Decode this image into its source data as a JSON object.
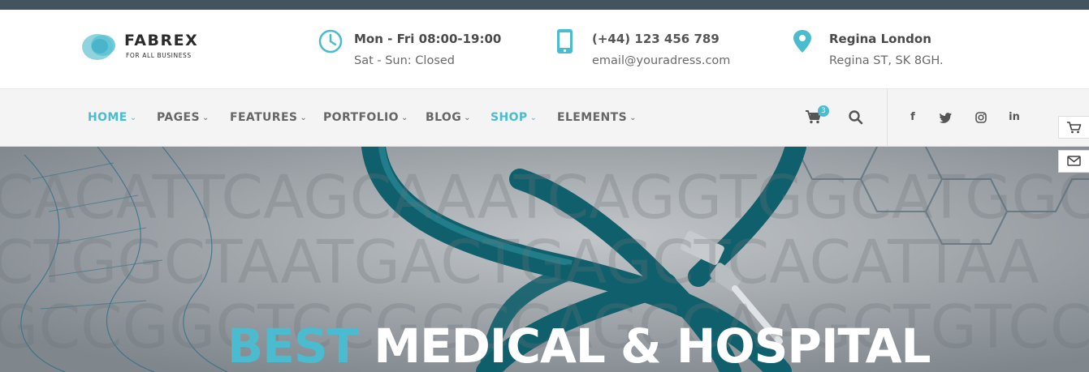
{
  "brand": {
    "name": "FABREX",
    "tagline": "FOR ALL BUSINESS",
    "accent_color": "#4bbcd0"
  },
  "header_info": {
    "hours": {
      "icon": "clock-icon",
      "line1": "Mon - Fri 08:00-19:00",
      "line2": "Sat - Sun: Closed"
    },
    "contact": {
      "icon": "phone-icon",
      "line1": "(+44) 123 456 789",
      "line2": "email@youradress.com"
    },
    "location": {
      "icon": "location-pin-icon",
      "line1": "Regina London",
      "line2": "Regina ST, SK 8GH."
    }
  },
  "nav": {
    "items": [
      {
        "label": "HOME",
        "active": true
      },
      {
        "label": "PAGES",
        "active": false
      },
      {
        "label": "FEATURES",
        "active": false
      },
      {
        "label": "PORTFOLIO",
        "active": false
      },
      {
        "label": "BLOG",
        "active": false
      },
      {
        "label": "SHOP",
        "active": true
      },
      {
        "label": "ELEMENTS",
        "active": false
      }
    ],
    "cart_count": "3",
    "social": [
      {
        "icon": "facebook-icon",
        "glyph": "f"
      },
      {
        "icon": "twitter-icon",
        "glyph": "t"
      },
      {
        "icon": "instagram-icon",
        "glyph": "ig"
      },
      {
        "icon": "linkedin-icon",
        "glyph": "in"
      }
    ]
  },
  "hero": {
    "title_accent": "BEST",
    "title_rest": "MEDICAL & HOSPITAL",
    "watermark_rows": [
      "CACATTCAGCAAATCAGGTGGCATGGCCAGA",
      "CTGGCTAATGACTGAGCTCACATTAA",
      "GCCGGCTCCGGCCAGCCAAGCTGTCCTG"
    ]
  },
  "side_buttons": [
    {
      "icon": "cart-icon"
    },
    {
      "icon": "mail-icon"
    }
  ]
}
